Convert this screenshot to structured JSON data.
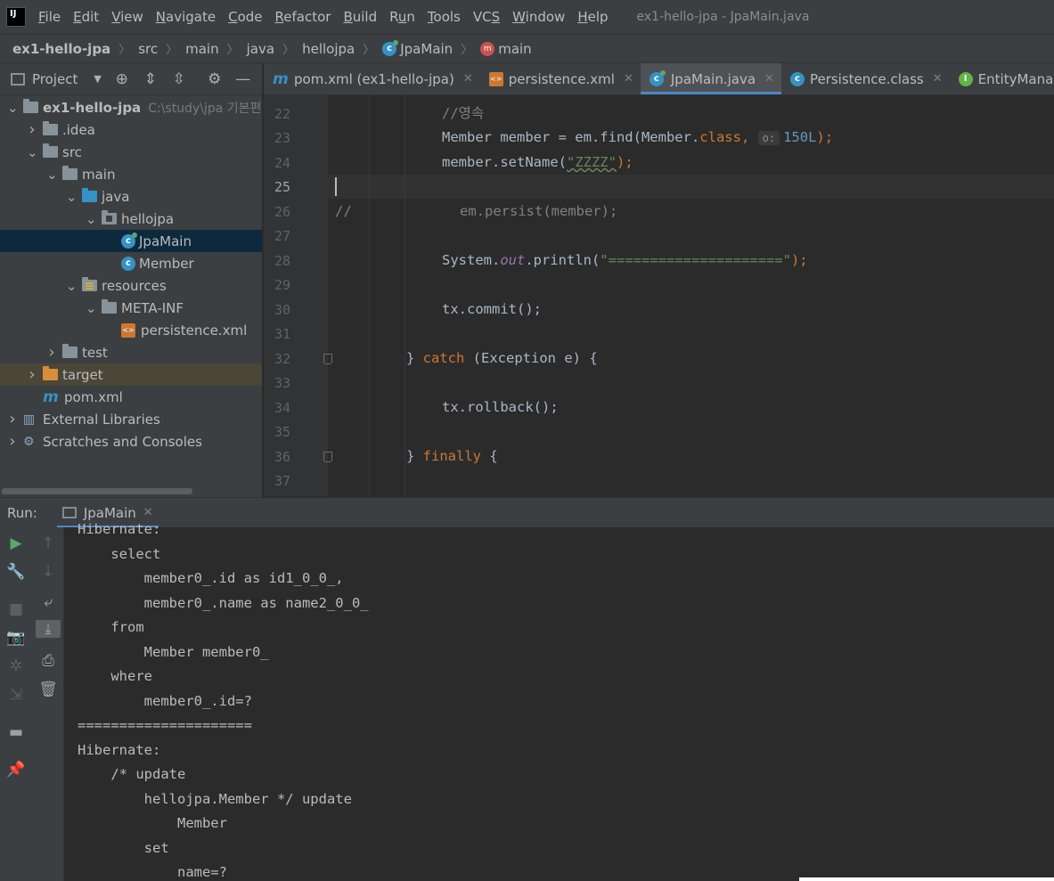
{
  "menubar": {
    "items": [
      "File",
      "Edit",
      "View",
      "Navigate",
      "Code",
      "Refactor",
      "Build",
      "Run",
      "Tools",
      "VCS",
      "Window",
      "Help"
    ],
    "mnemonics": [
      "F",
      "E",
      "V",
      "N",
      "C",
      "R",
      "B",
      "u",
      "T",
      "S",
      "W",
      "H"
    ],
    "window_title": "ex1-hello-jpa - JpaMain.java"
  },
  "breadcrumb": [
    "ex1-hello-jpa",
    "src",
    "main",
    "java",
    "hellojpa",
    "JpaMain",
    "main"
  ],
  "project": {
    "label": "Project",
    "root_hint": "C:\\study\\jpa 기본편",
    "tree": [
      {
        "label": "ex1-hello-jpa",
        "indent": 0,
        "arrow": "down",
        "icon": "module"
      },
      {
        "label": ".idea",
        "indent": 1,
        "arrow": "right",
        "icon": "folder"
      },
      {
        "label": "src",
        "indent": 1,
        "arrow": "down",
        "icon": "folder"
      },
      {
        "label": "main",
        "indent": 2,
        "arrow": "down",
        "icon": "folder"
      },
      {
        "label": "java",
        "indent": 3,
        "arrow": "down",
        "icon": "folder-blue"
      },
      {
        "label": "hellojpa",
        "indent": 4,
        "arrow": "down",
        "icon": "package"
      },
      {
        "label": "JpaMain",
        "indent": 5,
        "arrow": "",
        "icon": "class-run",
        "selected": true
      },
      {
        "label": "Member",
        "indent": 5,
        "arrow": "",
        "icon": "class"
      },
      {
        "label": "resources",
        "indent": 3,
        "arrow": "down",
        "icon": "folder-res"
      },
      {
        "label": "META-INF",
        "indent": 4,
        "arrow": "down",
        "icon": "folder"
      },
      {
        "label": "persistence.xml",
        "indent": 5,
        "arrow": "",
        "icon": "xml"
      },
      {
        "label": "test",
        "indent": 2,
        "arrow": "right",
        "icon": "folder"
      },
      {
        "label": "target",
        "indent": 1,
        "arrow": "right",
        "icon": "folder-orange",
        "target": true
      },
      {
        "label": "pom.xml",
        "indent": 1,
        "arrow": "",
        "icon": "maven"
      },
      {
        "label": "External Libraries",
        "indent": 0,
        "arrow": "right",
        "icon": "library"
      },
      {
        "label": "Scratches and Consoles",
        "indent": 0,
        "arrow": "right",
        "icon": "scratch"
      }
    ]
  },
  "editor": {
    "tabs": [
      {
        "label": "pom.xml (ex1-hello-jpa)",
        "icon": "maven"
      },
      {
        "label": "persistence.xml",
        "icon": "xml"
      },
      {
        "label": "JpaMain.java",
        "icon": "class-run",
        "active": true
      },
      {
        "label": "Persistence.class",
        "icon": "class-lock"
      },
      {
        "label": "EntityManager.class",
        "icon": "interface"
      }
    ],
    "line_numbers": [
      "22",
      "23",
      "24",
      "25",
      "26",
      "27",
      "28",
      "29",
      "30",
      "31",
      "32",
      "33",
      "34",
      "35",
      "36",
      "37"
    ],
    "code": {
      "l22": "//영속",
      "l23a": "Member member = em.find(Member.",
      "l23kw": "class",
      "l23b": ", ",
      "l23hint": "o:",
      "l23num": "150L",
      "l23c": ");",
      "l24a": "member.setName(",
      "l24str": "\"ZZZZ\"",
      "l24b": ");",
      "l26a": "//",
      "l26b": "em.persist(member);",
      "l28a": "System.",
      "l28fld": "out",
      "l28b": ".println(",
      "l28str": "\"=====================\"",
      "l28c": ");",
      "l30": "tx.commit();",
      "l32a": "} ",
      "l32kw": "catch",
      "l32b": " (Exception e) {",
      "l34": "tx.rollback();",
      "l36a": "} ",
      "l36kw": "finally",
      "l36b": " {"
    }
  },
  "run": {
    "label": "Run:",
    "tab_label": "JpaMain",
    "console_lines": [
      "Hibernate:",
      "    select",
      "        member0_.id as id1_0_0_,",
      "        member0_.name as name2_0_0_",
      "    from",
      "        Member member0_",
      "    where",
      "        member0_.id=?",
      "=====================",
      "Hibernate:",
      "    /* update",
      "        hellojpa.Member */ update",
      "            Member",
      "        set",
      "            name=?"
    ]
  },
  "colors": {
    "keyword": "#cc7832",
    "string": "#6a8759",
    "number": "#6897bb",
    "comment": "#808080",
    "selection": "#0d293e",
    "accent": "#4a88c7"
  }
}
